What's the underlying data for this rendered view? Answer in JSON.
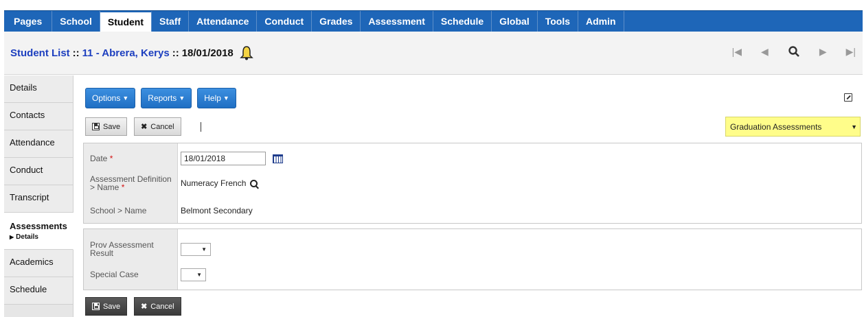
{
  "nav": {
    "tabs": [
      "Pages",
      "School",
      "Student",
      "Staff",
      "Attendance",
      "Conduct",
      "Grades",
      "Assessment",
      "Schedule",
      "Global",
      "Tools",
      "Admin"
    ],
    "active": "Student"
  },
  "title": {
    "list": "Student List",
    "sep1": "::",
    "student": "11 - Abrera, Kerys",
    "sep2": "::",
    "date": "18/01/2018"
  },
  "sidebar": {
    "items": [
      "Details",
      "Contacts",
      "Attendance",
      "Conduct",
      "Transcript",
      "Assessments",
      "Academics",
      "Schedule"
    ],
    "active_sub": "Details"
  },
  "toolbar": {
    "options": "Options",
    "reports": "Reports",
    "help": "Help",
    "save": "Save",
    "cancel": "Cancel"
  },
  "view_select": {
    "value": "Graduation Assessments"
  },
  "form": {
    "date_label": "Date",
    "date_value": "18/01/2018",
    "assess_label_1": "Assessment Definition",
    "assess_label_2": "> Name",
    "assess_value": "Numeracy French",
    "school_label": "School > Name",
    "school_value": "Belmont Secondary",
    "prov_label_1": "Prov Assessment",
    "prov_label_2": "Result",
    "special_label": "Special Case",
    "required_mark": "*"
  }
}
